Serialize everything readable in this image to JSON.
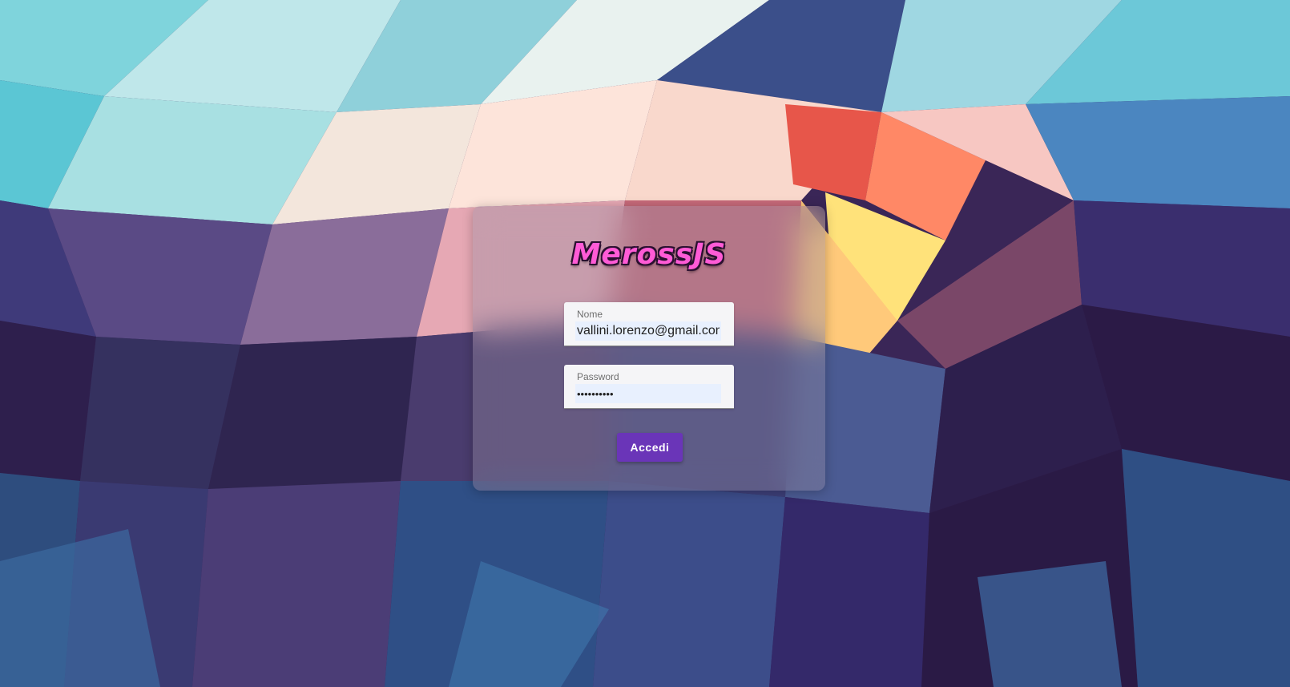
{
  "app": {
    "logo_text": "MerossJS"
  },
  "login_form": {
    "name_label": "Nome",
    "name_value": "vallini.lorenzo@gmail.com",
    "password_label": "Password",
    "password_value": "••••••••••",
    "submit_label": "Accedi"
  },
  "colors": {
    "accent": "#6a35b8",
    "logo": "#ff5bd6"
  }
}
